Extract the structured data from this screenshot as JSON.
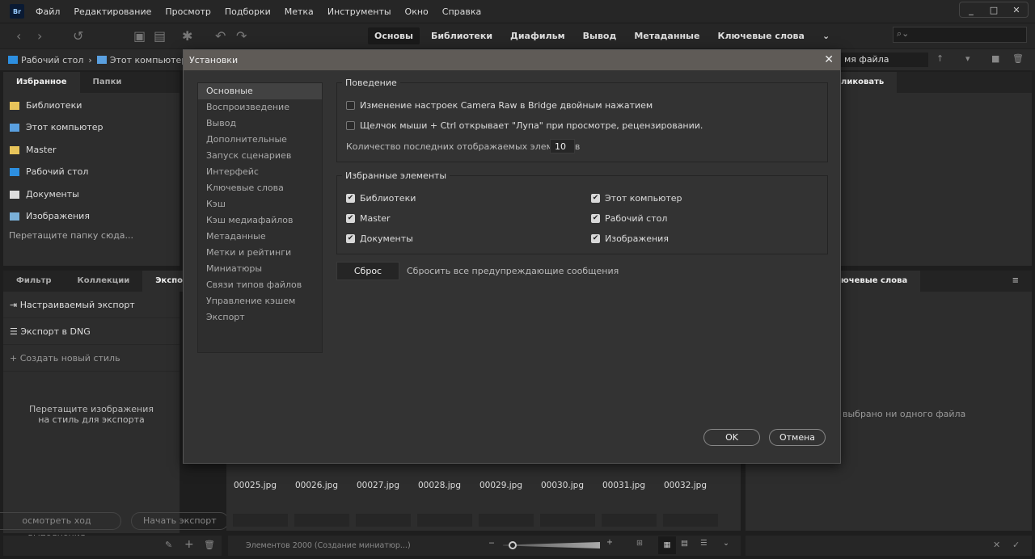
{
  "menu": {
    "logo": "Br",
    "items": [
      "Файл",
      "Редактирование",
      "Просмотр",
      "Подборки",
      "Метка",
      "Инструменты",
      "Окно",
      "Справка"
    ]
  },
  "window": {
    "minimize": "_",
    "maximize": "□",
    "close": "✕"
  },
  "workspaces": [
    "Основы",
    "Библиотеки",
    "Диафильм",
    "Вывод",
    "Метаданные",
    "Ключевые слова"
  ],
  "search": {
    "icon": "search-icon",
    "value": ""
  },
  "path": [
    "Рабочий стол",
    "Этот компьютер"
  ],
  "sort": {
    "label": "мя файла"
  },
  "left_tabs": [
    "Избранное",
    "Папки"
  ],
  "favorites": [
    {
      "label": "Библиотеки",
      "color": "#e8c45a"
    },
    {
      "label": "Этот компьютер",
      "color": "#5aa0e0"
    },
    {
      "label": "Master",
      "color": "#e8c45a"
    },
    {
      "label": "Рабочий стол",
      "color": "#2d8fe0"
    },
    {
      "label": "Документы",
      "color": "#dddddd"
    },
    {
      "label": "Изображения",
      "color": "#7ab0d8"
    }
  ],
  "favorites_hint": "Перетащите папку сюда...",
  "bottom_tabs": [
    "Фильтр",
    "Коллекции",
    "Экспорт"
  ],
  "export": {
    "items": [
      "Настраиваемый экспорт",
      "Экспорт в DNG",
      "Создать новый стиль"
    ],
    "hint_line1": "Перетащите изображения",
    "hint_line2": "на стиль для экспорта",
    "progress_button": "осмотреть ход выполнения",
    "start_button": "Начать экспорт"
  },
  "right": {
    "top_tab": "ликовать",
    "bottom_tab": "ючевые слова",
    "empty": "выбрано ни одного файла"
  },
  "thumbnails": [
    "00025.jpg",
    "00026.jpg",
    "00027.jpg",
    "00028.jpg",
    "00029.jpg",
    "00030.jpg",
    "00031.jpg",
    "00032.jpg"
  ],
  "status": "Элементов 2000 (Создание миниатюр...)",
  "dialog": {
    "title": "Установки",
    "categories": [
      "Основные",
      "Воспроизведение",
      "Вывод",
      "Дополнительные",
      "Запуск сценариев",
      "Интерфейс",
      "Ключевые слова",
      "Кэш",
      "Кэш медиафайлов",
      "Метаданные",
      "Метки и рейтинги",
      "Миниатюры",
      "Связи типов файлов",
      "Управление кэшем",
      "Экспорт"
    ],
    "selected_category": "Основные",
    "behavior": {
      "legend": "Поведение",
      "opt1": {
        "label": "Изменение настроек Camera Raw в Bridge двойным нажатием",
        "checked": false
      },
      "opt2": {
        "label": "Щелчок мыши + Ctrl открывает \"Лупа\" при просмотре, рецензировании.",
        "checked": false
      },
      "recent_label": "Количество последних отображаемых элементов",
      "recent_value": "10"
    },
    "favorites": {
      "legend": "Избранные элементы",
      "items": [
        {
          "label": "Библиотеки",
          "checked": true
        },
        {
          "label": "Master",
          "checked": true
        },
        {
          "label": "Документы",
          "checked": true
        },
        {
          "label": "Этот компьютер",
          "checked": true
        },
        {
          "label": "Рабочий стол",
          "checked": true
        },
        {
          "label": "Изображения",
          "checked": true
        }
      ]
    },
    "reset_button": "Сброс",
    "reset_label": "Сбросить все предупреждающие сообщения",
    "ok": "OK",
    "cancel": "Отмена"
  }
}
